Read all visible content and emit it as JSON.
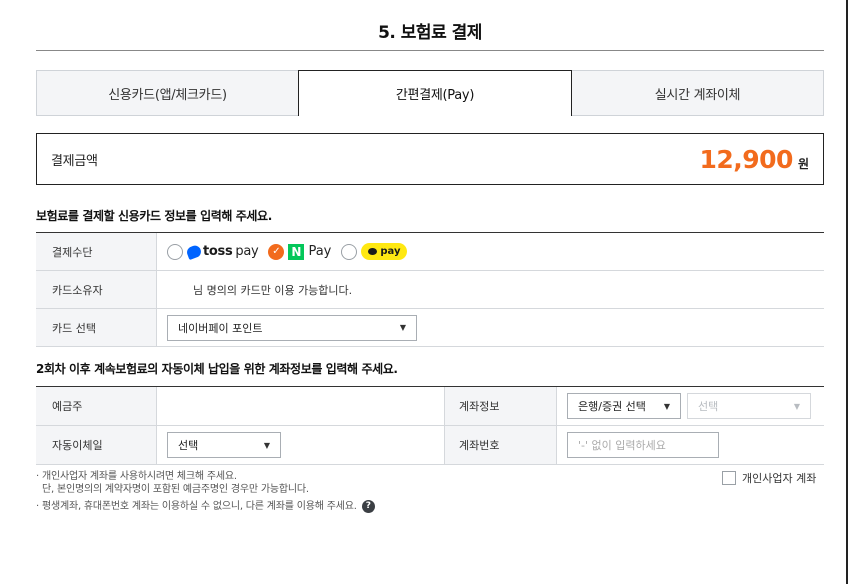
{
  "title": "5. 보험료 결제",
  "tabs": [
    {
      "label": "신용카드(앱/체크카드)",
      "active": false
    },
    {
      "label": "간편결제(Pay)",
      "active": true
    },
    {
      "label": "실시간 계좌이체",
      "active": false
    }
  ],
  "amount": {
    "label": "결제금액",
    "value": "12,900",
    "unit": "원"
  },
  "card_section": {
    "heading": "보험료를 결제할 신용카드 정보를 입력해 주세요.",
    "method_label": "결제수단",
    "pay_options": [
      {
        "name": "toss",
        "brand": "toss",
        "suffix": "pay",
        "checked": false
      },
      {
        "name": "npay",
        "mark": "N",
        "suffix": "Pay",
        "checked": true
      },
      {
        "name": "kakaopay",
        "suffix": "pay",
        "checked": false
      }
    ],
    "owner_label": "카드소유자",
    "owner_text": "님 명의의 카드만 이용 가능합니다.",
    "card_select_label": "카드 선택",
    "card_select_value": "네이버페이 포인트"
  },
  "account_section": {
    "heading": "2회차 이후 계속보험료의 자동이체 납입을 위한 계좌정보를 입력해 주세요.",
    "depositor_label": "예금주",
    "depositor_value": "",
    "account_info_label": "계좌정보",
    "bank_select_value": "은행/증권 선택",
    "bank_select2_value": "선택",
    "transfer_day_label": "자동이체일",
    "transfer_day_value": "선택",
    "account_number_label": "계좌번호",
    "account_number_placeholder": "'-' 없이 입력하세요"
  },
  "notes": [
    "· 개인사업자 계좌를 사용하시려면 체크해 주세요.",
    "  단, 본인명의의 계약자명이 포함된 예금주명인 경우만 가능합니다.",
    "· 평생계좌, 휴대폰번호 계좌는 이용하실 수 없으니, 다른 계좌를 이용해 주세요."
  ],
  "business_account_label": "개인사업자 계좌",
  "colors": {
    "accent": "#f26b1d",
    "npay_green": "#03c75a",
    "toss_blue": "#0064ff",
    "kakao_yellow": "#ffe812"
  }
}
